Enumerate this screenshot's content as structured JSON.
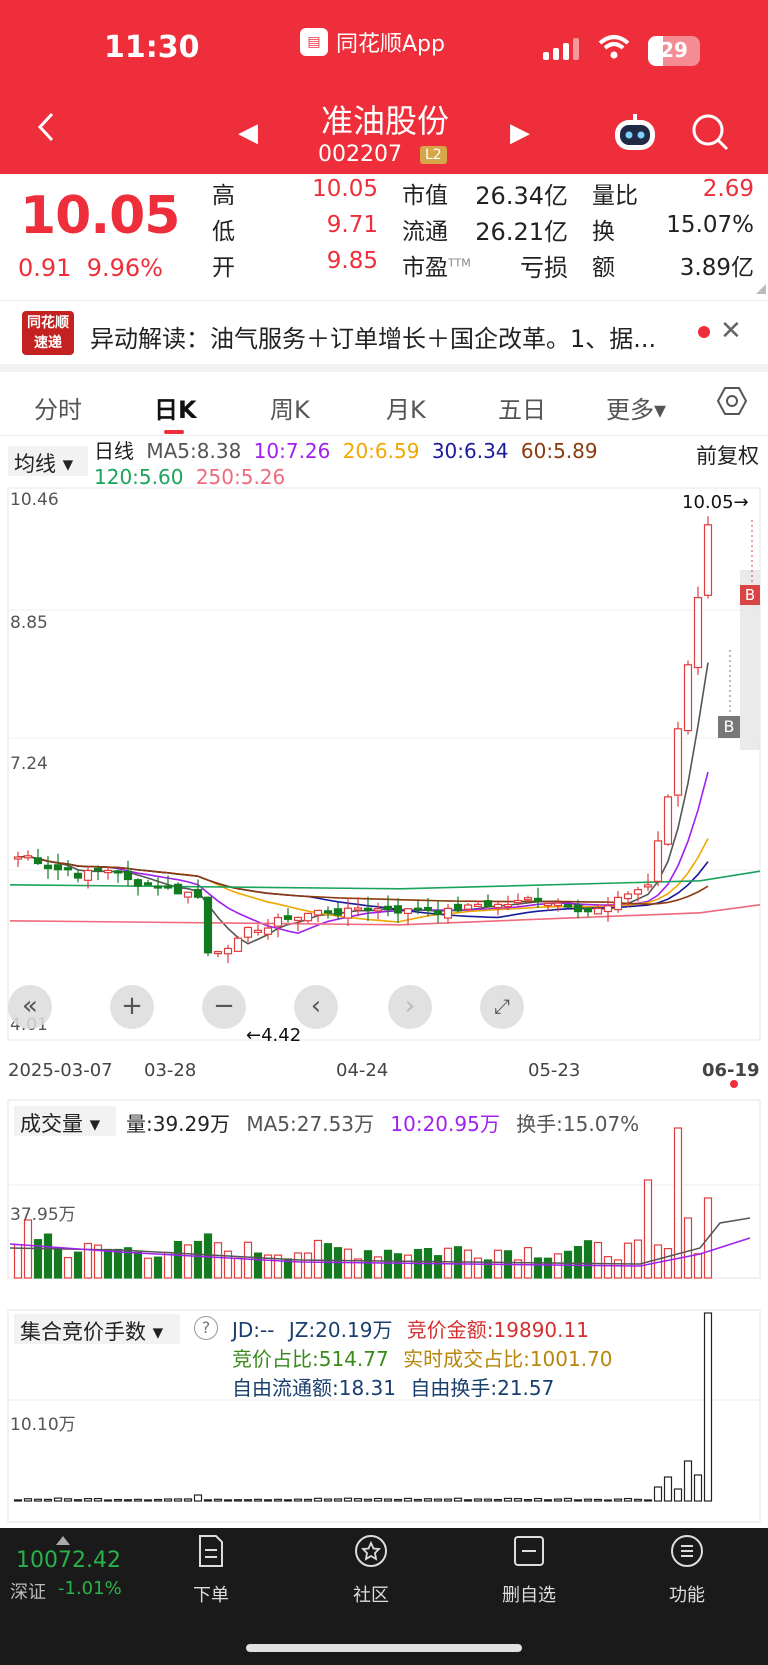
{
  "status": {
    "time": "11:30",
    "battery": "29",
    "app_name": "同花顺App"
  },
  "stock": {
    "name": "准油股份",
    "code": "002207",
    "level_badge": "L2"
  },
  "quote": {
    "price": "10.05",
    "change": "0.91",
    "change_pct": "9.96%",
    "rows": [
      {
        "l1": "高",
        "v1": "10.05",
        "l2": "市值",
        "v2": "26.34亿",
        "l3": "量比",
        "v3": "2.69"
      },
      {
        "l1": "低",
        "v1": "9.71",
        "l2": "流通",
        "v2": "26.21亿",
        "l3": "换",
        "v3": "15.07%"
      },
      {
        "l1": "开",
        "v1": "9.85",
        "l2": "市盈",
        "l2_sup": "TTM",
        "v2": "亏损",
        "l3": "额",
        "v3": "3.89亿"
      }
    ]
  },
  "anomaly": {
    "logo": "同花顺速递",
    "text": "异动解读：油气服务＋订单增长＋国企改革。1、据..."
  },
  "tabs": [
    "分时",
    "日K",
    "周K",
    "月K",
    "五日",
    "更多▾"
  ],
  "active_tab": "日K",
  "ma_legend": {
    "selector": "均线 ▾",
    "items": [
      {
        "text": "日线",
        "color": "#222222"
      },
      {
        "text": "MA5:8.38",
        "color": "#555555"
      },
      {
        "text": "10:7.26",
        "color": "#a020f0"
      },
      {
        "text": "20:6.59",
        "color": "#f0a800"
      },
      {
        "text": "30:6.34",
        "color": "#1a1a9c"
      },
      {
        "text": "60:5.89",
        "color": "#8b3a0e"
      },
      {
        "text": "120:5.60",
        "color": "#1aa35a"
      },
      {
        "text": "250:5.26",
        "color": "#f06a7e"
      }
    ],
    "adjust": "前复权"
  },
  "kchart": {
    "axis_labels": [
      "10.46",
      "8.85",
      "7.24",
      "4.01"
    ],
    "high_label": "10.05→",
    "low_label": "←4.42",
    "buy_marker": "B",
    "dates": [
      "2025-03-07",
      "03-28",
      "04-24",
      "05-23",
      "06-19"
    ]
  },
  "volume": {
    "selector": "成交量 ▾",
    "items": [
      {
        "text": "量:39.29万",
        "color": "#222222"
      },
      {
        "text": "MA5:27.53万",
        "color": "#555555"
      },
      {
        "text": "10:20.95万",
        "color": "#a020f0"
      },
      {
        "text": "换手:15.07%",
        "color": "#555555"
      }
    ],
    "axis_label": "37.95万"
  },
  "auction": {
    "selector": "集合竞价手数 ▾",
    "help": "?",
    "line1": [
      {
        "text": "JD:--",
        "color": "#1a3f6e"
      },
      {
        "text": "JZ:20.19万",
        "color": "#1a3f6e"
      },
      {
        "text": "竞价金额:19890.11",
        "color": "#d43030"
      }
    ],
    "line2": [
      {
        "text": "竞价占比:514.77",
        "color": "#3a8a1a"
      },
      {
        "text": "实时成交占比:1001.70",
        "color": "#b8860b"
      }
    ],
    "line3": [
      {
        "text": "自由流通额:18.31",
        "color": "#1a3f6e"
      },
      {
        "text": "自由换手:21.57",
        "color": "#1a3f6e"
      }
    ],
    "axis_label": "10.10万"
  },
  "bottom": {
    "index_value": "10072.42",
    "index_name": "深证",
    "index_change": "-1.01%",
    "nav": [
      "下单",
      "社区",
      "删自选",
      "功能"
    ]
  }
}
